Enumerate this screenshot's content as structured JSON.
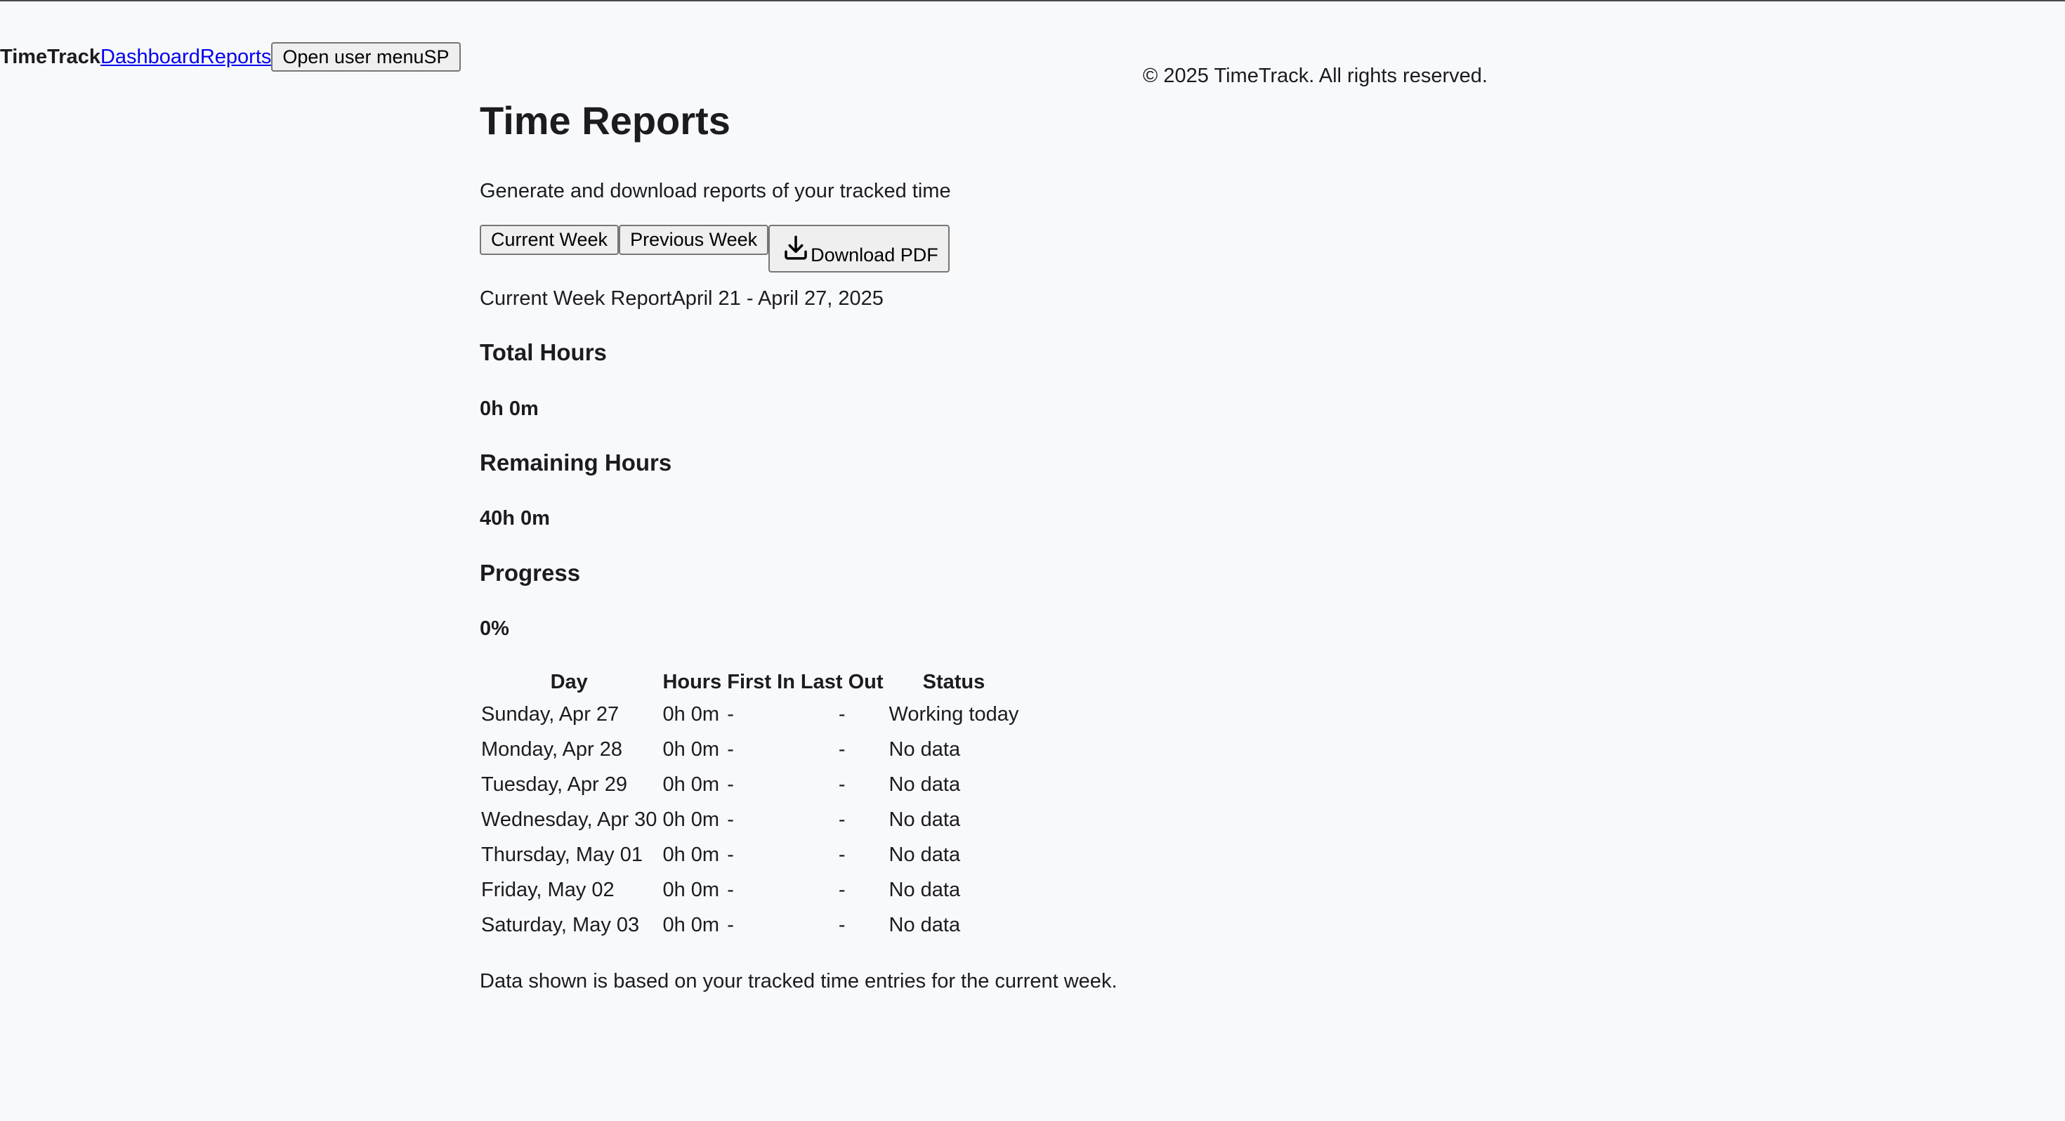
{
  "nav": {
    "brand": "TimeTrack",
    "links": [
      "Dashboard",
      "Reports"
    ],
    "user_menu_label": "Open user menu",
    "user_initials": "SP"
  },
  "footer": {
    "text": "© 2025 TimeTrack. All rights reserved."
  },
  "page": {
    "title": "Time Reports",
    "subtitle": "Generate and download reports of your tracked time"
  },
  "controls": {
    "current_week": "Current Week",
    "previous_week": "Previous Week",
    "download_pdf": "Download PDF",
    "download_icon": "download-icon"
  },
  "report": {
    "heading": "Current Week Report",
    "range": "April 21 - April 27, 2025"
  },
  "stats": {
    "total_label": "Total Hours",
    "total_value": "0h 0m",
    "remaining_label": "Remaining Hours",
    "remaining_value": "40h 0m",
    "progress_label": "Progress",
    "progress_value": "0%"
  },
  "table": {
    "headers": [
      "Day",
      "Hours",
      "First In",
      "Last Out",
      "Status"
    ],
    "rows": [
      {
        "day": "Sunday, Apr 27",
        "hours": "0h 0m",
        "first_in": "-",
        "last_out": "-",
        "status": "Working today"
      },
      {
        "day": "Monday, Apr 28",
        "hours": "0h 0m",
        "first_in": "-",
        "last_out": "-",
        "status": "No data"
      },
      {
        "day": "Tuesday, Apr 29",
        "hours": "0h 0m",
        "first_in": "-",
        "last_out": "-",
        "status": "No data"
      },
      {
        "day": "Wednesday, Apr 30",
        "hours": "0h 0m",
        "first_in": "-",
        "last_out": "-",
        "status": "No data"
      },
      {
        "day": "Thursday, May 01",
        "hours": "0h 0m",
        "first_in": "-",
        "last_out": "-",
        "status": "No data"
      },
      {
        "day": "Friday, May 02",
        "hours": "0h 0m",
        "first_in": "-",
        "last_out": "-",
        "status": "No data"
      },
      {
        "day": "Saturday, May 03",
        "hours": "0h 0m",
        "first_in": "-",
        "last_out": "-",
        "status": "No data"
      }
    ]
  },
  "note": "Data shown is based on your tracked time entries for the current week."
}
